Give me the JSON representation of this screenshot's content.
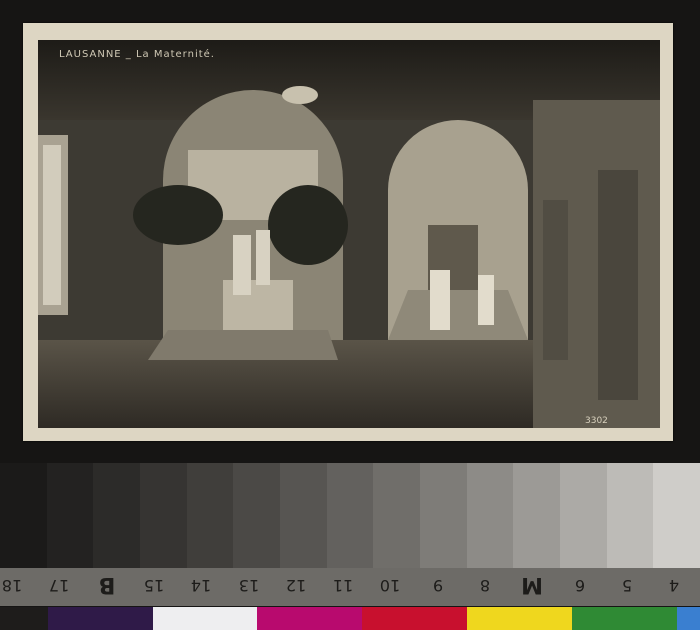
{
  "postcard": {
    "caption": "LAUSANNE _ La Maternité.",
    "plate_number": "3302"
  },
  "calibration_target": {
    "gray_patches": [
      "#1b1a19",
      "#232221",
      "#2c2b29",
      "#363432",
      "#403e3b",
      "#4b4946",
      "#575552",
      "#63615e",
      "#706e6a",
      "#7e7c78",
      "#8d8b87",
      "#9c9a96",
      "#acaaa6",
      "#bdbbb7",
      "#cfcdc9"
    ],
    "scale_labels": [
      "18",
      "17",
      "B",
      "15",
      "14",
      "13",
      "12",
      "11",
      "10",
      "9",
      "8",
      "M",
      "6",
      "5",
      "4"
    ],
    "color_patches": [
      "#1e1c1b",
      "#2f1a48",
      "#eeeef0",
      "#b80a6e",
      "#c8102e",
      "#efd71e",
      "#2f8a34",
      "#3a7fd0"
    ]
  }
}
